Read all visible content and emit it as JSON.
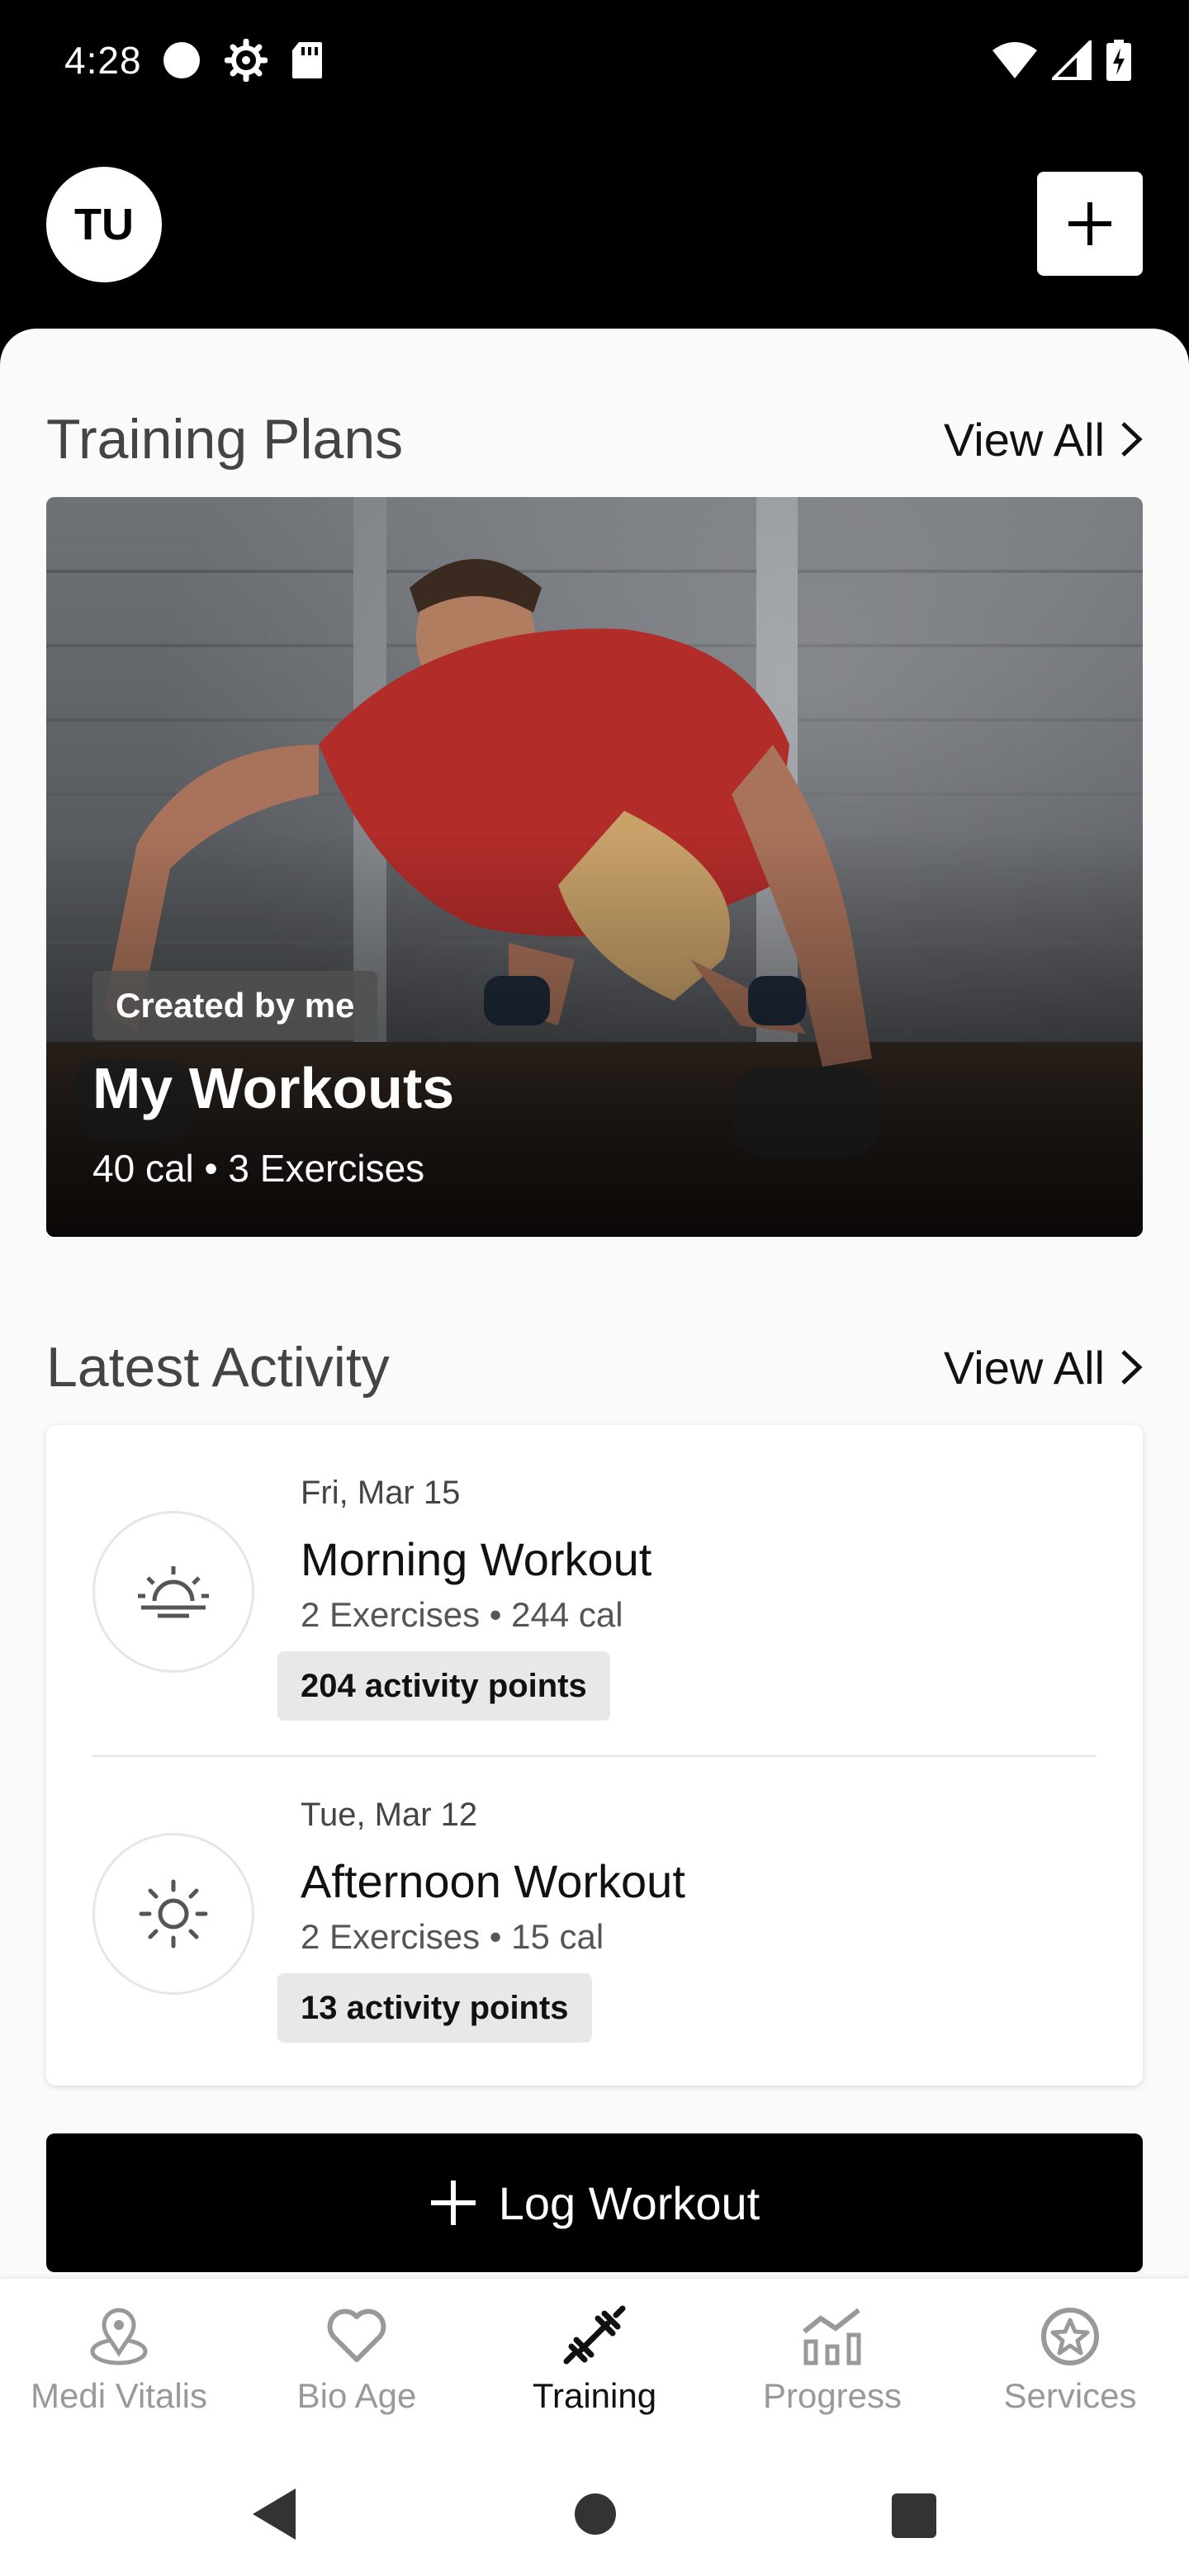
{
  "status_bar": {
    "time": "4:28"
  },
  "header": {
    "avatar_initials": "TU"
  },
  "training_plans": {
    "title": "Training Plans",
    "view_all": "View All",
    "plan": {
      "tag": "Created by me",
      "name": "My Workouts",
      "meta": "40 cal • 3 Exercises"
    }
  },
  "latest_activity": {
    "title": "Latest Activity",
    "view_all": "View All",
    "items": [
      {
        "date": "Fri, Mar 15",
        "name": "Morning Workout",
        "meta": "2 Exercises • 244 cal",
        "points": "204 activity points",
        "icon": "sunrise-icon"
      },
      {
        "date": "Tue, Mar 12",
        "name": "Afternoon Workout",
        "meta": "2 Exercises • 15 cal",
        "points": "13 activity points",
        "icon": "sun-icon"
      }
    ]
  },
  "log_workout": {
    "label": "Log Workout"
  },
  "bottom_nav": {
    "items": [
      {
        "label": "Medi Vitalis",
        "icon": "location-pin-icon"
      },
      {
        "label": "Bio Age",
        "icon": "heart-icon"
      },
      {
        "label": "Training",
        "icon": "dumbbell-icon",
        "active": true
      },
      {
        "label": "Progress",
        "icon": "chart-icon"
      },
      {
        "label": "Services",
        "icon": "star-badge-icon"
      }
    ]
  },
  "colors": {
    "accent": "#000000",
    "background": "#fafafa",
    "chip": "#e8e8e8"
  }
}
